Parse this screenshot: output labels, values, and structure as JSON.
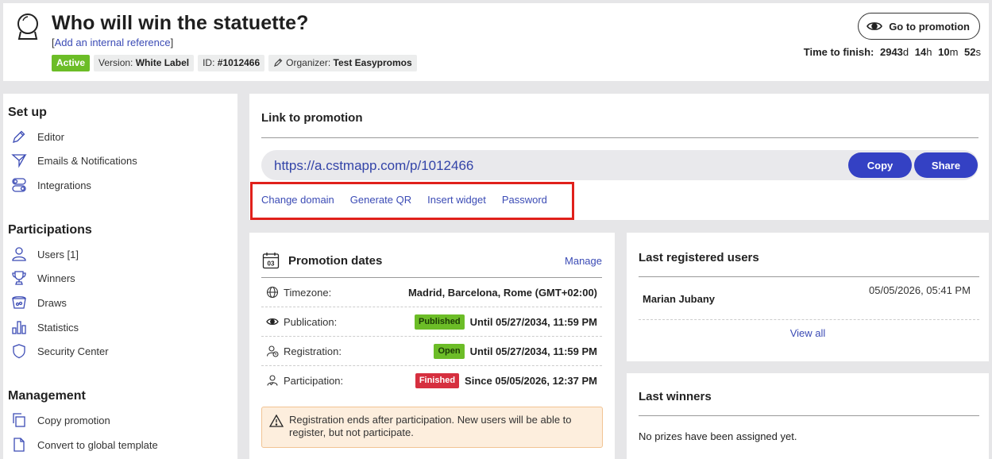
{
  "header": {
    "title": "Who will win the statuette?",
    "internal_ref_link": "Add an internal reference",
    "badge_active": "Active",
    "version_label": "Version:",
    "version_value": "White Label",
    "id_label": "ID:",
    "id_value": "#1012466",
    "organizer_label": "Organizer:",
    "organizer_value": "Test Easypromos",
    "goto_label": "Go to promotion",
    "time_label": "Time to finish:",
    "time_days": "2943",
    "time_hours": "14",
    "time_minutes": "10",
    "time_seconds": "52",
    "unit_d": "d",
    "unit_h": "h",
    "unit_m": "m",
    "unit_s": "s"
  },
  "sidebar": {
    "setup_title": "Set up",
    "setup_items": [
      "Editor",
      "Emails & Notifications",
      "Integrations"
    ],
    "participations_title": "Participations",
    "participation_items": [
      "Users [1]",
      "Winners",
      "Draws",
      "Statistics",
      "Security Center"
    ],
    "management_title": "Management",
    "management_items": [
      "Copy promotion",
      "Convert to global template"
    ]
  },
  "link_panel": {
    "title": "Link to promotion",
    "url": "https://a.cstmapp.com/p/1012466",
    "copy_label": "Copy",
    "share_label": "Share",
    "actions": [
      "Change domain",
      "Generate QR",
      "Insert widget",
      "Password"
    ]
  },
  "dates_panel": {
    "title": "Promotion dates",
    "calendar_day": "03",
    "manage_label": "Manage",
    "rows": [
      {
        "label": "Timezone:",
        "status": "",
        "value": "Madrid, Barcelona, Rome (GMT+02:00)"
      },
      {
        "label": "Publication:",
        "status": "Published",
        "value": "Until 05/27/2034, 11:59 PM"
      },
      {
        "label": "Registration:",
        "status": "Open",
        "value": "Until 05/27/2034, 11:59 PM"
      },
      {
        "label": "Participation:",
        "status": "Finished",
        "value": "Since 05/05/2026, 12:37 PM"
      }
    ],
    "warning": "Registration ends after participation. New users will be able to register, but not participate."
  },
  "users_panel": {
    "title": "Last registered users",
    "user_name": "Marian Jubany",
    "user_date": "05/05/2026, 05:41 PM",
    "view_all": "View all"
  },
  "winners_panel": {
    "title": "Last winners",
    "empty_text": "No prizes have been assigned yet."
  },
  "colors": {
    "accent_blue": "#3441c4",
    "active_green": "#6cbd27",
    "finished_red": "#d62f3f",
    "highlight_red": "#e0201b"
  }
}
